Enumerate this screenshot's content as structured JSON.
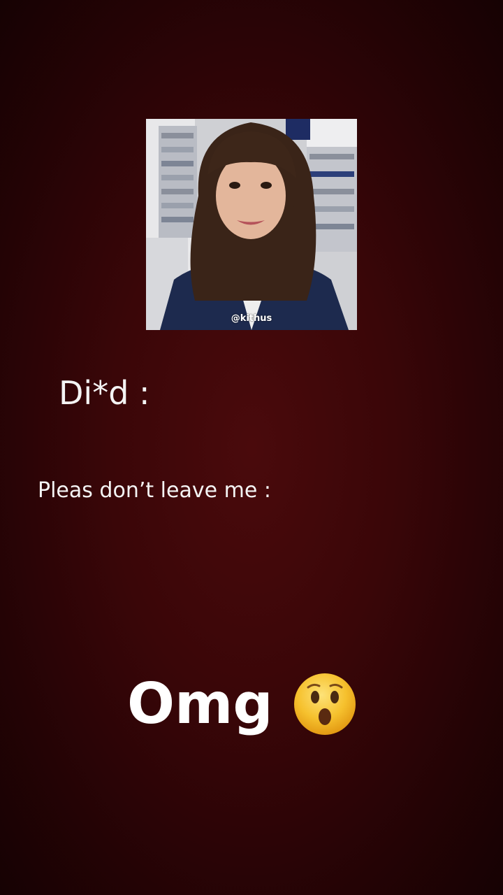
{
  "photo": {
    "watermark": "@kithus",
    "description_icon": "woman-photo"
  },
  "captions": {
    "line1": "Di*d :",
    "line2": "Pleas don’t leave me :",
    "line3": "Omg"
  },
  "emoji": {
    "name": "astonished-face-icon"
  },
  "colors": {
    "background": "#3a0608",
    "text": "#ffffff",
    "emoji_face": "#f6c12e"
  }
}
